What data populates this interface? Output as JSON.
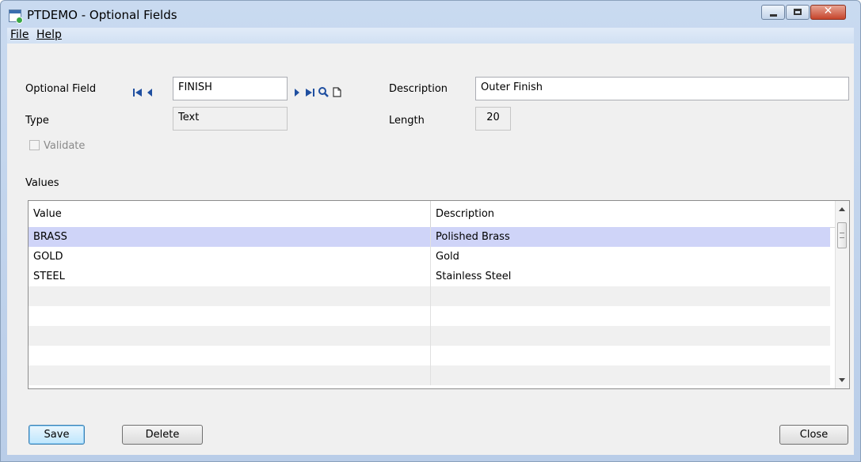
{
  "window": {
    "title": "PTDEMO - Optional Fields"
  },
  "window_buttons": {
    "min_icon": "minimize-icon",
    "max_icon": "maximize-icon",
    "close_glyph": "✕"
  },
  "menu": {
    "items": [
      {
        "label": "File"
      },
      {
        "label": "Help"
      }
    ]
  },
  "form": {
    "optional_field_label": "Optional Field",
    "optional_field_value": "FINISH",
    "description_label": "Description",
    "description_value": "Outer Finish",
    "type_label": "Type",
    "type_value": "Text",
    "length_label": "Length",
    "length_value": "20",
    "validate_label": "Validate",
    "validate_checked": false
  },
  "navigation_icons": [
    "first-record-icon",
    "previous-record-icon",
    "next-record-icon",
    "last-record-icon",
    "finder-icon",
    "new-document-icon"
  ],
  "values_section": {
    "title": "Values",
    "columns": [
      "Value",
      "Description"
    ],
    "rows": [
      {
        "value": "BRASS",
        "description": "Polished Brass"
      },
      {
        "value": "GOLD",
        "description": "Gold"
      },
      {
        "value": "STEEL",
        "description": "Stainless Steel"
      }
    ],
    "selected_row": 0
  },
  "buttons": {
    "save": "Save",
    "delete": "Delete",
    "close": "Close"
  },
  "colors": {
    "selection": "#cfd4f8",
    "alt_row": "#f0f0f0",
    "nav_icon": "#1f4fa0",
    "close_button": "#c6452c"
  }
}
